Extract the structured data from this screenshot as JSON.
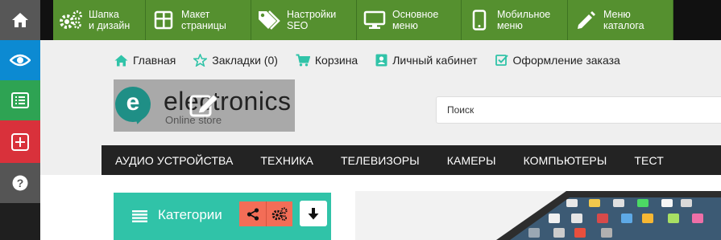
{
  "rail": {
    "colors": {
      "home": "#575757",
      "view": "#0c8ad2",
      "list": "#2ea353",
      "add": "#d9313b",
      "help": "#555555"
    }
  },
  "toolbar": {
    "items": [
      {
        "label": "Шапка\nи дизайн",
        "icon": "gears-icon"
      },
      {
        "label": "Макет\nстраницы",
        "icon": "layout-icon"
      },
      {
        "label": "Настройки\nSEO",
        "icon": "tags-icon"
      },
      {
        "label": "Основное\nменю",
        "icon": "monitor-icon"
      },
      {
        "label": "Мобильное\nменю",
        "icon": "mobile-icon"
      },
      {
        "label": "Меню\nкаталога",
        "icon": "pencil-icon"
      }
    ],
    "color": "#55902f"
  },
  "header_links": {
    "home": "Главная",
    "bookmarks": "Закладки (0)",
    "cart": "Корзина",
    "account": "Личный кабинет",
    "checkout": "Оформление заказа"
  },
  "logo": {
    "letter": "e",
    "name": "electronics",
    "tagline": "Online store"
  },
  "search": {
    "placeholder": "Поиск"
  },
  "nav": {
    "items": [
      "АУДИО УСТРОЙСТВА",
      "ТЕХНИКА",
      "ТЕЛЕВИЗОРЫ",
      "КАМЕРЫ",
      "КОМПЬЮТЕРЫ",
      "ТЕСТ"
    ]
  },
  "categories": {
    "title": "Категории"
  },
  "accent": {
    "teal": "#30c3a8",
    "coral": "#f36d57"
  }
}
